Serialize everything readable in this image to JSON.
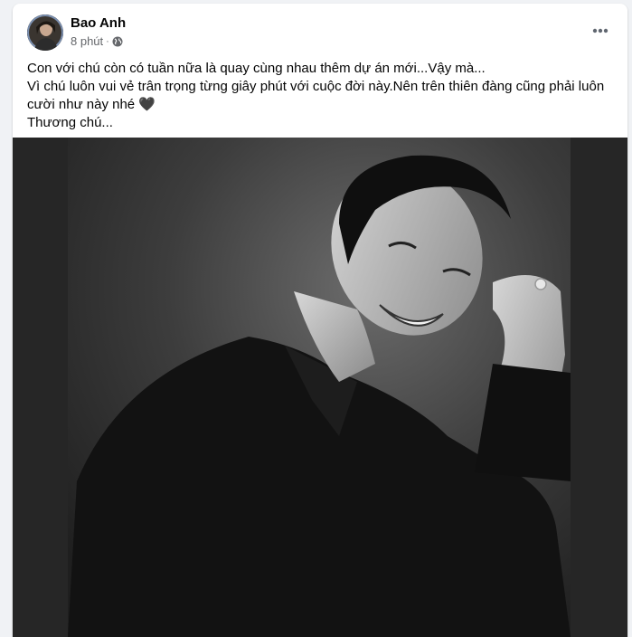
{
  "post": {
    "author": "Bao Anh",
    "time": "8 phút",
    "separator": "·",
    "privacy_icon": "globe-icon",
    "menu_icon": "more-horizontal-icon",
    "caption_lines": [
      "Con với chú còn có tuần nữa là quay cùng nhau thêm dự án mới...Vậy mà...",
      "Vì chú luôn vui vẻ trân trọng từng giây phút với cuộc đời này.Nên trên thiên đàng cũng phải luôn",
      "cười như này nhé 🖤",
      "Thương chú..."
    ]
  },
  "colors": {
    "page_bg": "#f0f2f5",
    "card_bg": "#ffffff",
    "text_primary": "#050505",
    "text_secondary": "#65676b"
  }
}
